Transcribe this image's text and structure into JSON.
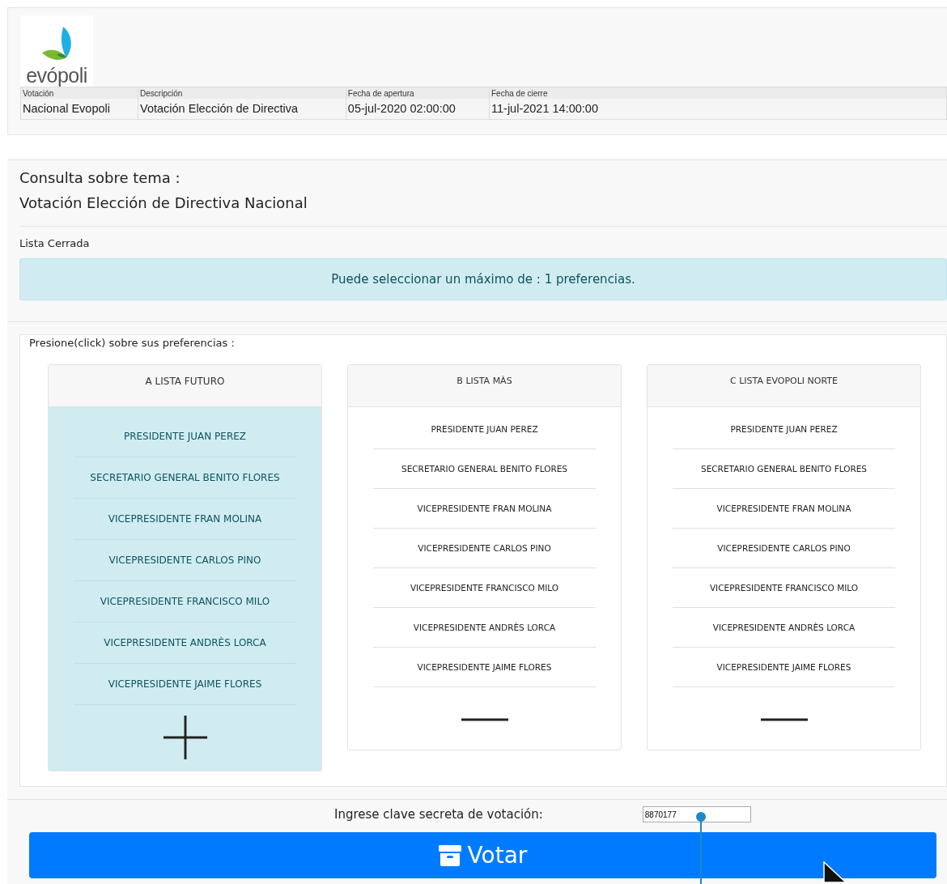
{
  "logo": {
    "text": "evópoli"
  },
  "info_table": {
    "columns": [
      "Votación",
      "Descripción",
      "Fecha de apertura",
      "Fecha de cierre"
    ],
    "rows": [
      [
        "Nacional Evopoli",
        "Votación Elección de Directiva",
        "05-jul-2020 02:00:00",
        "11-jul-2021 14:00:00"
      ]
    ]
  },
  "consulta": {
    "heading": "Consulta sobre tema :",
    "topic": "Votación Elección de Directiva Nacional",
    "type": "Lista Cerrada",
    "alert": "Puede seleccionar un máximo de : 1 preferencias."
  },
  "lists_prompt": "Presione(click) sobre sus preferencias :",
  "lists": [
    {
      "title": "A LISTA FUTURO",
      "selected": true,
      "candidates": [
        "PRESIDENTE JUAN PEREZ",
        "SECRETARIO GENERAL BENITO FLORES",
        "VICEPRESIDENTE FRAN MOLINA",
        "VICEPRESIDENTE CARLOS PINO",
        "VICEPRESIDENTE FRANCISCO MILO",
        "VICEPRESIDENTE ANDRÈS LORCA",
        "VICEPRESIDENTE JAIME FLORES"
      ]
    },
    {
      "title": "B LISTA MÀS",
      "selected": false,
      "candidates": [
        "PRESIDENTE JUAN PEREZ",
        "SECRETARIO GENERAL BENITO FLORES",
        "VICEPRESIDENTE FRAN MOLINA",
        "VICEPRESIDENTE CARLOS PINO",
        "VICEPRESIDENTE FRANCISCO MILO",
        "VICEPRESIDENTE ANDRÈS LORCA",
        "VICEPRESIDENTE JAIME FLORES"
      ]
    },
    {
      "title": "C LISTA EVOPOLI NORTE",
      "selected": false,
      "candidates": [
        "PRESIDENTE JUAN PEREZ",
        "SECRETARIO GENERAL BENITO FLORES",
        "VICEPRESIDENTE FRAN MOLINA",
        "VICEPRESIDENTE CARLOS PINO",
        "VICEPRESIDENTE FRANCISCO MILO",
        "VICEPRESIDENTE ANDRÈS LORCA",
        "VICEPRESIDENTE JAIME FLORES"
      ]
    }
  ],
  "password": {
    "label": "Ingrese clave secreta de votación:",
    "value": "8870177"
  },
  "vote_button": {
    "label": "Votar"
  }
}
